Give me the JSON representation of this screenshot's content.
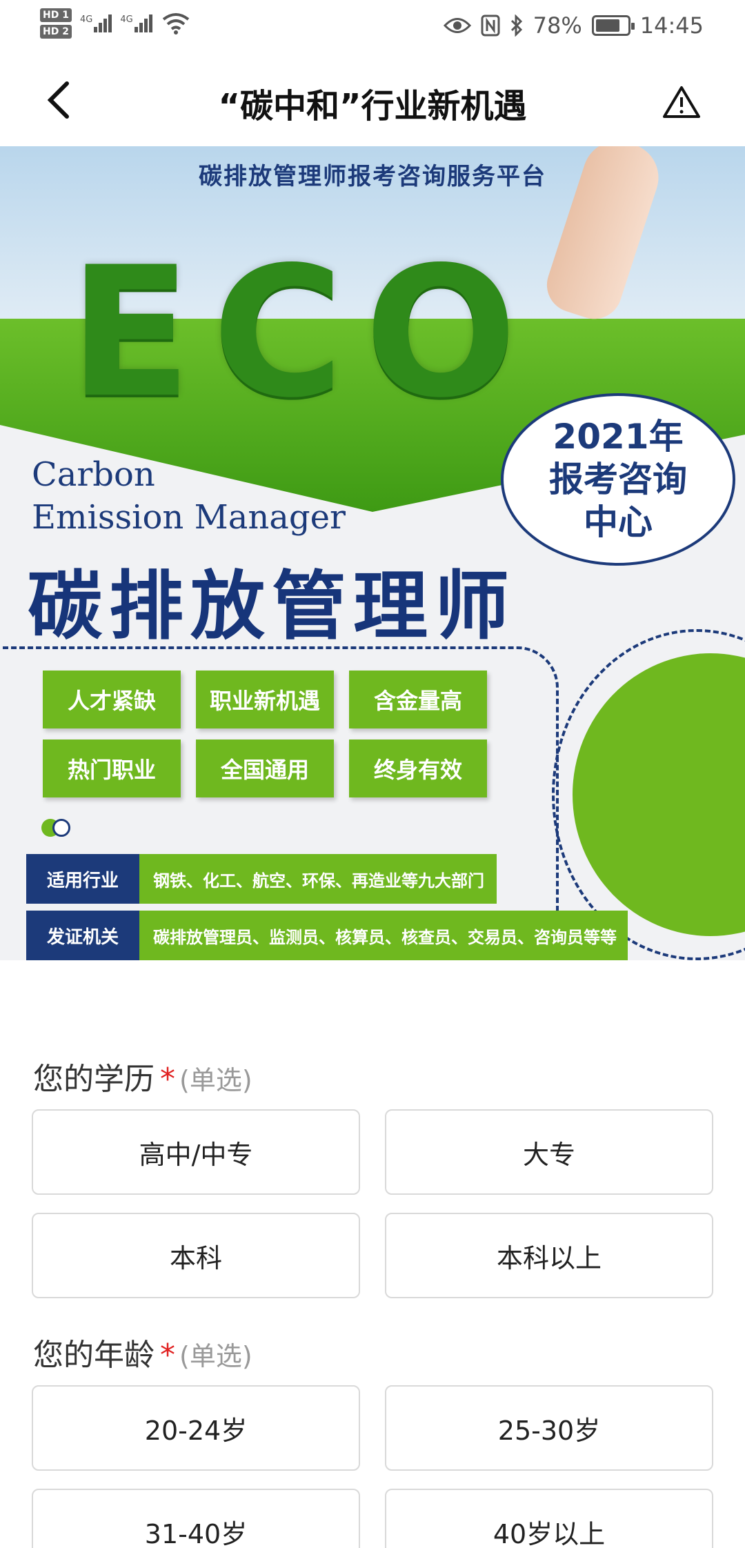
{
  "status_bar": {
    "hd1": "HD 1",
    "hd2": "HD 2",
    "net1": "4G",
    "net2": "4G",
    "battery_pct": "78%",
    "battery_level": 0.78,
    "time": "14:45",
    "icons": [
      "eye-icon",
      "nfc-icon",
      "bluetooth-icon",
      "wifi-icon",
      "battery-icon"
    ]
  },
  "header": {
    "title": "“碳中和”行业新机遇",
    "back_icon": "chevron-left-icon",
    "report_icon": "warning-icon"
  },
  "banner": {
    "top_text": "碳排放管理师报考咨询服务平台",
    "eco_text": "ECO",
    "badge_year": "2021年",
    "badge_line2": "报考咨询",
    "badge_line3": "中心",
    "english_line1": "Carbon",
    "english_line2": "Emission Manager",
    "main_title": "碳排放管理师",
    "tags": [
      "人才紧缺",
      "职业新机遇",
      "含金量高",
      "热门职业",
      "全国通用",
      "终身有效"
    ],
    "industry_label": "适用行业",
    "industry_value": "钢铁、化工、航空、环保、再造业等九大部门",
    "cert_label": "发证机关",
    "cert_value": "碳排放管理员、监测员、核算员、核查员、交易员、咨询员等等",
    "colors": {
      "navy": "#1c3a7a",
      "green": "#6fb81f"
    }
  },
  "form": {
    "education": {
      "label": "您的学历",
      "required_mark": "*",
      "hint": "(单选)",
      "options": [
        "高中/中专",
        "大专",
        "本科",
        "本科以上"
      ]
    },
    "age": {
      "label": "您的年龄",
      "required_mark": "*",
      "hint": "(单选)",
      "options": [
        "20-24岁",
        "25-30岁",
        "31-40岁",
        "40岁以上"
      ]
    }
  }
}
